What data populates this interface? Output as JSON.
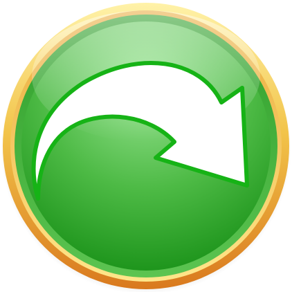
{
  "button": {
    "icon": "redo-arrow-icon",
    "action": "redo"
  },
  "colors": {
    "rim_light": "#FFF2A8",
    "rim_mid": "#F2C44A",
    "rim_dark": "#D9791E",
    "face_light": "#9BE594",
    "face_mid": "#4DBA45",
    "face_dark": "#108A10",
    "arrow_fill": "#FFFFFF",
    "arrow_outline": "#16B316"
  }
}
